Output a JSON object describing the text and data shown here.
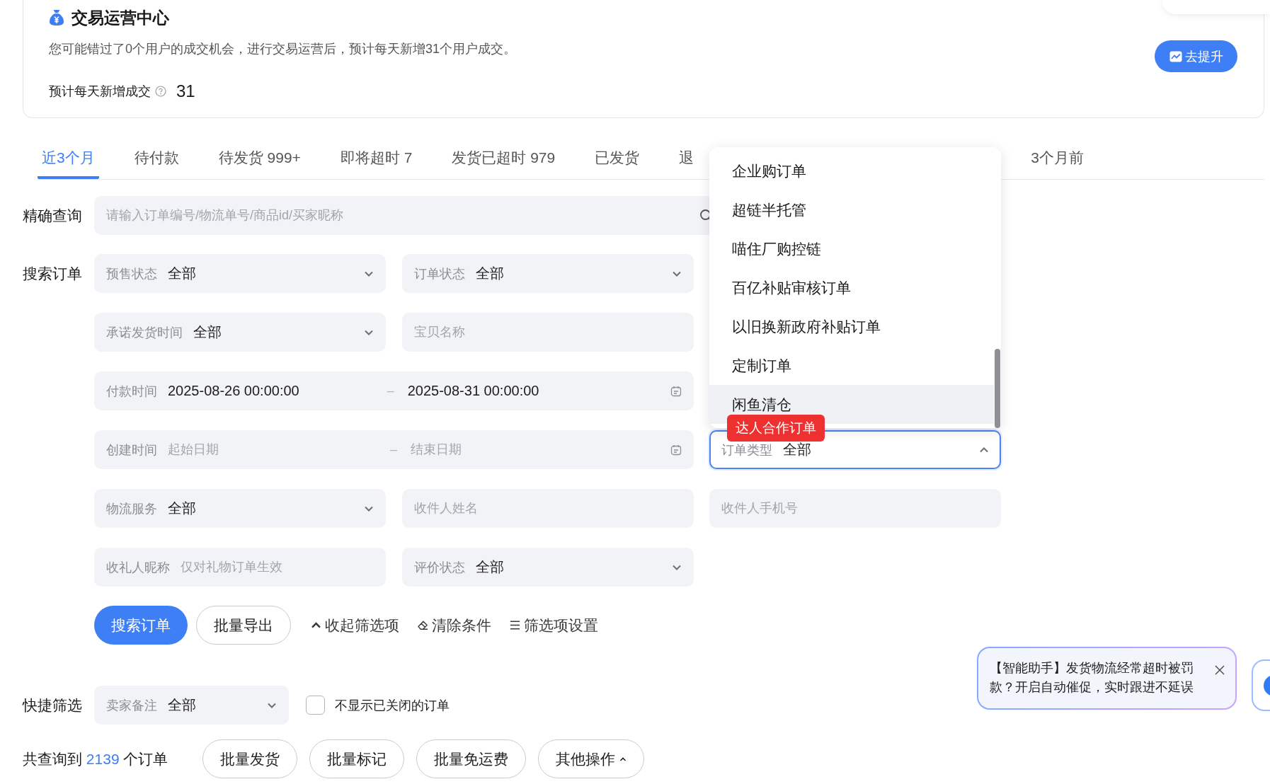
{
  "header_card": {
    "title": "交易运营中心",
    "description": "您可能错过了0个用户的成交机会，进行交易运营后，预计每天新增31个用户成交。",
    "metric_label": "预计每天新增成交",
    "metric_value": "31",
    "action_button": "去提升"
  },
  "tabs": [
    {
      "label": "近3个月",
      "selected": true
    },
    {
      "label": "待付款",
      "selected": false
    },
    {
      "label": "待发货 999+",
      "selected": false
    },
    {
      "label": "即将超时 7",
      "selected": false
    },
    {
      "label": "发货已超时 979",
      "selected": false
    },
    {
      "label": "已发货",
      "selected": false
    },
    {
      "label": "退",
      "selected": false
    },
    {
      "label": "3个月前",
      "selected": false
    }
  ],
  "precise_query": {
    "label": "精确查询",
    "placeholder": "请输入订单编号/物流单号/商品id/买家昵称"
  },
  "search_form": {
    "label": "搜索订单",
    "rows": [
      {
        "fields": [
          {
            "kind": "select",
            "label": "预售状态",
            "value": "全部",
            "expanded": false
          },
          {
            "kind": "select",
            "label": "订单状态",
            "value": "全部",
            "expanded": false
          }
        ]
      },
      {
        "fields": [
          {
            "kind": "select",
            "label": "承诺发货时间",
            "value": "全部",
            "expanded": false
          },
          {
            "kind": "text",
            "placeholder": "宝贝名称"
          }
        ]
      },
      {
        "fields": [
          {
            "kind": "date_range",
            "label": "付款时间",
            "start": "2025-08-26 00:00:00",
            "separator": "–",
            "end": "2025-08-31 00:00:00"
          }
        ]
      },
      {
        "fields": [
          {
            "kind": "date_range",
            "label": "创建时间",
            "start_placeholder": "起始日期",
            "separator": "–",
            "end_placeholder": "结束日期"
          },
          {
            "kind": "select",
            "label": "订单类型",
            "value": "全部",
            "expanded": true,
            "tag": "达人合作订单",
            "options": [
              {
                "label": "企业购订单",
                "highlighted": false
              },
              {
                "label": "超链半托管",
                "highlighted": false
              },
              {
                "label": "喵住厂购控链",
                "highlighted": false
              },
              {
                "label": "百亿补贴审核订单",
                "highlighted": false
              },
              {
                "label": "以旧换新政府补贴订单",
                "highlighted": false
              },
              {
                "label": "定制订单",
                "highlighted": false
              },
              {
                "label": "闲鱼清仓",
                "highlighted": true
              }
            ]
          }
        ]
      },
      {
        "fields": [
          {
            "kind": "select",
            "label": "物流服务",
            "value": "全部",
            "expanded": false
          },
          {
            "kind": "text",
            "placeholder": "收件人姓名"
          },
          {
            "kind": "text",
            "placeholder": "收件人手机号"
          }
        ]
      },
      {
        "fields": [
          {
            "kind": "labeled_text",
            "label": "收礼人昵称",
            "placeholder": "仅对礼物订单生效"
          },
          {
            "kind": "select",
            "label": "评价状态",
            "value": "全部",
            "expanded": false
          }
        ]
      }
    ],
    "buttons": [
      {
        "kind": "primary",
        "label": "搜索订单"
      },
      {
        "kind": "outline",
        "label": "批量导出"
      }
    ],
    "links": [
      "收起筛选项",
      "清除条件",
      "筛选项设置"
    ]
  },
  "quick_filter": {
    "label": "快捷筛选",
    "select": {
      "label": "卖家备注",
      "value": "全部",
      "expanded": false
    },
    "checkbox": {
      "label": "不显示已关闭的订单",
      "checked": false
    }
  },
  "results": {
    "prefix": "共查询到",
    "count": "2139",
    "suffix": "个订单",
    "buttons": [
      {
        "kind": "plain",
        "label": "批量发货"
      },
      {
        "kind": "plain",
        "label": "批量标记"
      },
      {
        "kind": "plain",
        "label": "批量免运费"
      },
      {
        "kind": "menu",
        "label": "其他操作"
      }
    ]
  },
  "assistant_tip": {
    "message": "【智能助手】发货物流经常超时被罚款？开启自动催促，实时跟进不延误"
  }
}
